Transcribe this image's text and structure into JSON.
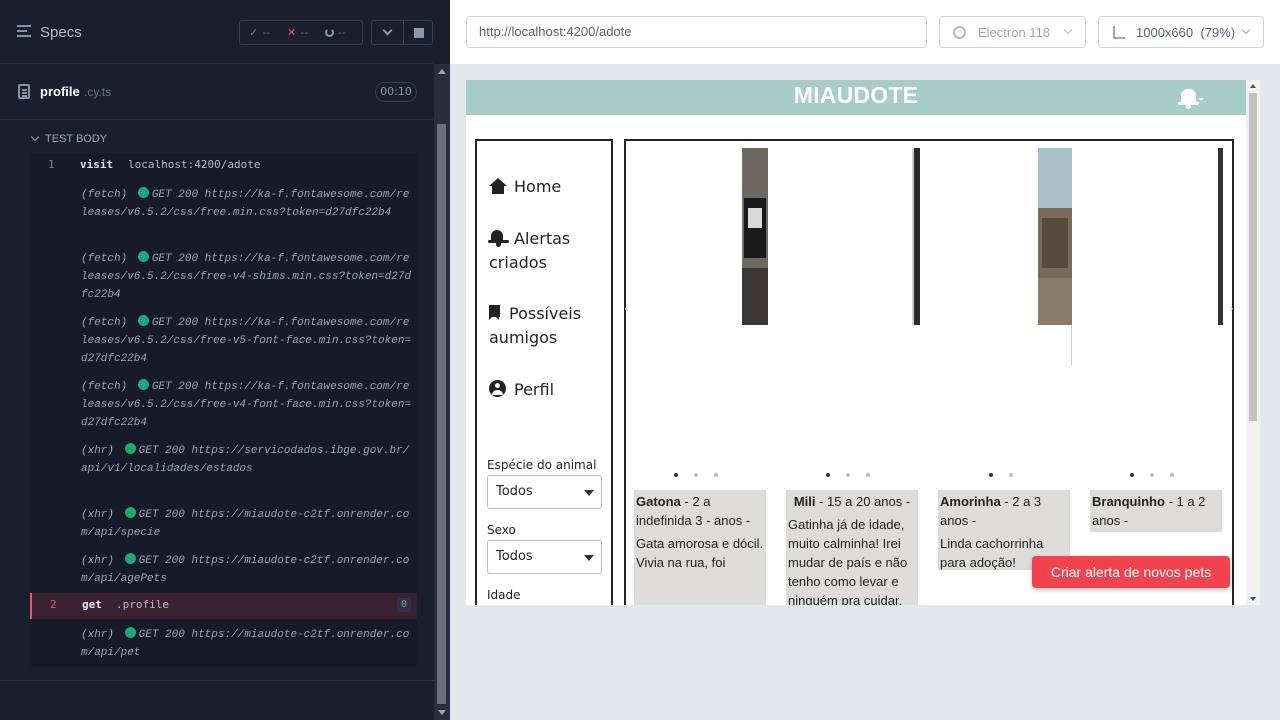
{
  "runner": {
    "specs_label": "Specs",
    "stats": {
      "passed": "--",
      "failed": "--",
      "pending": "--"
    },
    "spec": {
      "name": "profile",
      "ext": ".cy.ts",
      "duration": "00:10"
    },
    "test_body_label": "TEST BODY",
    "commands": [
      {
        "num": "1",
        "name": "visit",
        "message": "localhost:4200/adote"
      },
      {
        "type": "(fetch)",
        "method": "GET",
        "status": "200",
        "url": "https://ka-f.fontawesome.com/releases/v6.5.2/css/free.min.css?token=d27dfc22b4"
      },
      {
        "type": "(fetch)",
        "method": "GET",
        "status": "200",
        "url": "https://ka-f.fontawesome.com/releases/v6.5.2/css/free-v4-shims.min.css?token=d27dfc22b4"
      },
      {
        "type": "(fetch)",
        "method": "GET",
        "status": "200",
        "url": "https://ka-f.fontawesome.com/releases/v6.5.2/css/free-v5-font-face.min.css?token=d27dfc22b4"
      },
      {
        "type": "(fetch)",
        "method": "GET",
        "status": "200",
        "url": "https://ka-f.fontawesome.com/releases/v6.5.2/css/free-v4-font-face.min.css?token=d27dfc22b4"
      },
      {
        "type": "(xhr)",
        "method": "GET",
        "status": "200",
        "url": "https://servicodados.ibge.gov.br/api/v1/localidades/estados"
      },
      {
        "type": "(xhr)",
        "method": "GET",
        "status": "200",
        "url": "https://miaudote-c2tf.onrender.com/api/specie"
      },
      {
        "type": "(xhr)",
        "method": "GET",
        "status": "200",
        "url": "https://miaudote-c2tf.onrender.com/api/agePets"
      },
      {
        "num": "2",
        "name": "get",
        "message": ".profile",
        "badge": "0"
      },
      {
        "type": "(xhr)",
        "method": "GET",
        "status": "200",
        "url": "https://miaudote-c2tf.onrender.com/api/pet"
      }
    ]
  },
  "aut_header": {
    "url": "http://localhost:4200/adote",
    "browser": "Electron 118",
    "viewport": "1000x660",
    "zoom": "(79%)"
  },
  "app": {
    "title": "MIAUDOTE",
    "nav": [
      {
        "label": "Home",
        "icon": "home-icon"
      },
      {
        "label": "Alertas criados",
        "icon": "bell-icon"
      },
      {
        "label": "Possíveis aumigos",
        "icon": "bookmark-icon"
      },
      {
        "label": "Perfil",
        "icon": "user-circle-icon"
      }
    ],
    "filters": [
      {
        "label": "Espécie do animal",
        "value": "Todos"
      },
      {
        "label": "Sexo",
        "value": "Todos"
      },
      {
        "label": "Idade",
        "value": ""
      }
    ],
    "pets": [
      {
        "name": "Gatona",
        "age": "- 2 a indefinida 3 - anos -",
        "description": "Gata amorosa e dócil. Vivia na rua, foi",
        "dots": 3,
        "active_dot": 0
      },
      {
        "name": "Mili",
        "age": "- 15 a 20 anos -",
        "description": "Gatinha já de idade, muito calminha! Irei mudar de país e não tenho como levar e ninguém pra cuidar.",
        "dots": 3,
        "active_dot": 0
      },
      {
        "name": "Amorinha",
        "age": "- 2 a 3 anos -",
        "description": "Linda cachorrinha para adoção!",
        "dots": 2,
        "active_dot": 0
      },
      {
        "name": "Branquinho",
        "age": "- 1 a 2 anos -",
        "description": "",
        "dots": 3,
        "active_dot": 0
      }
    ],
    "alert_button": "Criar alerta de novos pets",
    "colors": {
      "header": "#a8cdc4",
      "alert_button": "#f0434e",
      "info_bg": "#dedcd8"
    }
  }
}
